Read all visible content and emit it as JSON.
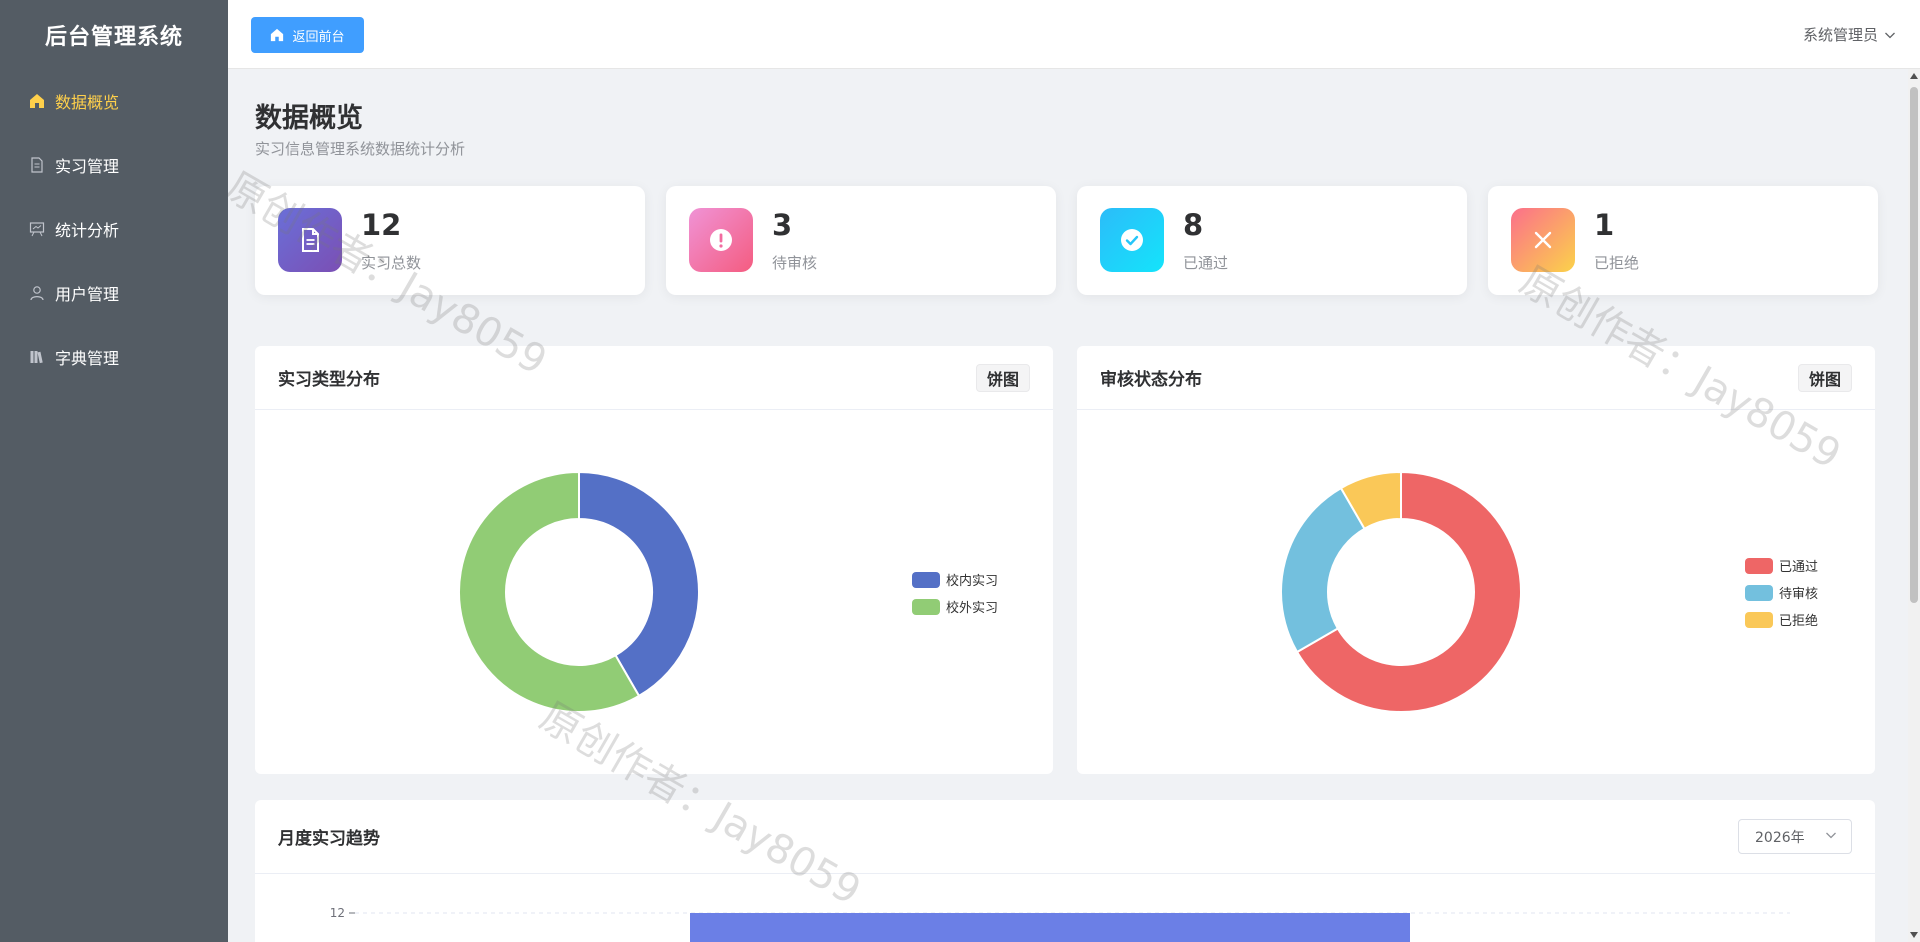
{
  "app": {
    "title": "后台管理系统"
  },
  "sidebar": {
    "items": [
      {
        "label": "数据概览",
        "icon": "home-icon",
        "active": true
      },
      {
        "label": "实习管理",
        "icon": "document-icon"
      },
      {
        "label": "统计分析",
        "icon": "presentation-icon"
      },
      {
        "label": "用户管理",
        "icon": "user-icon"
      },
      {
        "label": "字典管理",
        "icon": "books-icon"
      }
    ]
  },
  "header": {
    "back_label": "返回前台",
    "user_label": "系统管理员"
  },
  "page": {
    "title": "数据概览",
    "subtitle": "实习信息管理系统数据统计分析"
  },
  "stats": [
    {
      "value": "12",
      "label": "实习总数",
      "icon": "document-icon"
    },
    {
      "value": "3",
      "label": "待审核",
      "icon": "alert-icon"
    },
    {
      "value": "8",
      "label": "已通过",
      "icon": "check-icon"
    },
    {
      "value": "1",
      "label": "已拒绝",
      "icon": "close-icon"
    }
  ],
  "panels": {
    "type_dist": {
      "title": "实习类型分布",
      "button": "饼图"
    },
    "status_dist": {
      "title": "审核状态分布",
      "button": "饼图"
    },
    "monthly": {
      "title": "月度实习趋势",
      "year": "2026年"
    }
  },
  "watermark": "原创作者：Jay8059",
  "chart_data": [
    {
      "type": "pie",
      "title": "实习类型分布",
      "categories": [
        "校内实习",
        "校外实习"
      ],
      "values": [
        5,
        7
      ],
      "colors": [
        "#5470c6",
        "#91cc75"
      ],
      "legend": "right"
    },
    {
      "type": "pie",
      "title": "审核状态分布",
      "categories": [
        "已通过",
        "待审核",
        "已拒绝"
      ],
      "values": [
        8,
        3,
        1
      ],
      "colors": [
        "#ee6666",
        "#73c0de",
        "#fac858"
      ],
      "legend": "right"
    },
    {
      "type": "bar",
      "title": "月度实习趋势",
      "categories": [
        "2026年"
      ],
      "values": [
        12
      ],
      "y_tick_labels": [
        "12"
      ],
      "colors": [
        "#6b7fe6"
      ]
    }
  ]
}
